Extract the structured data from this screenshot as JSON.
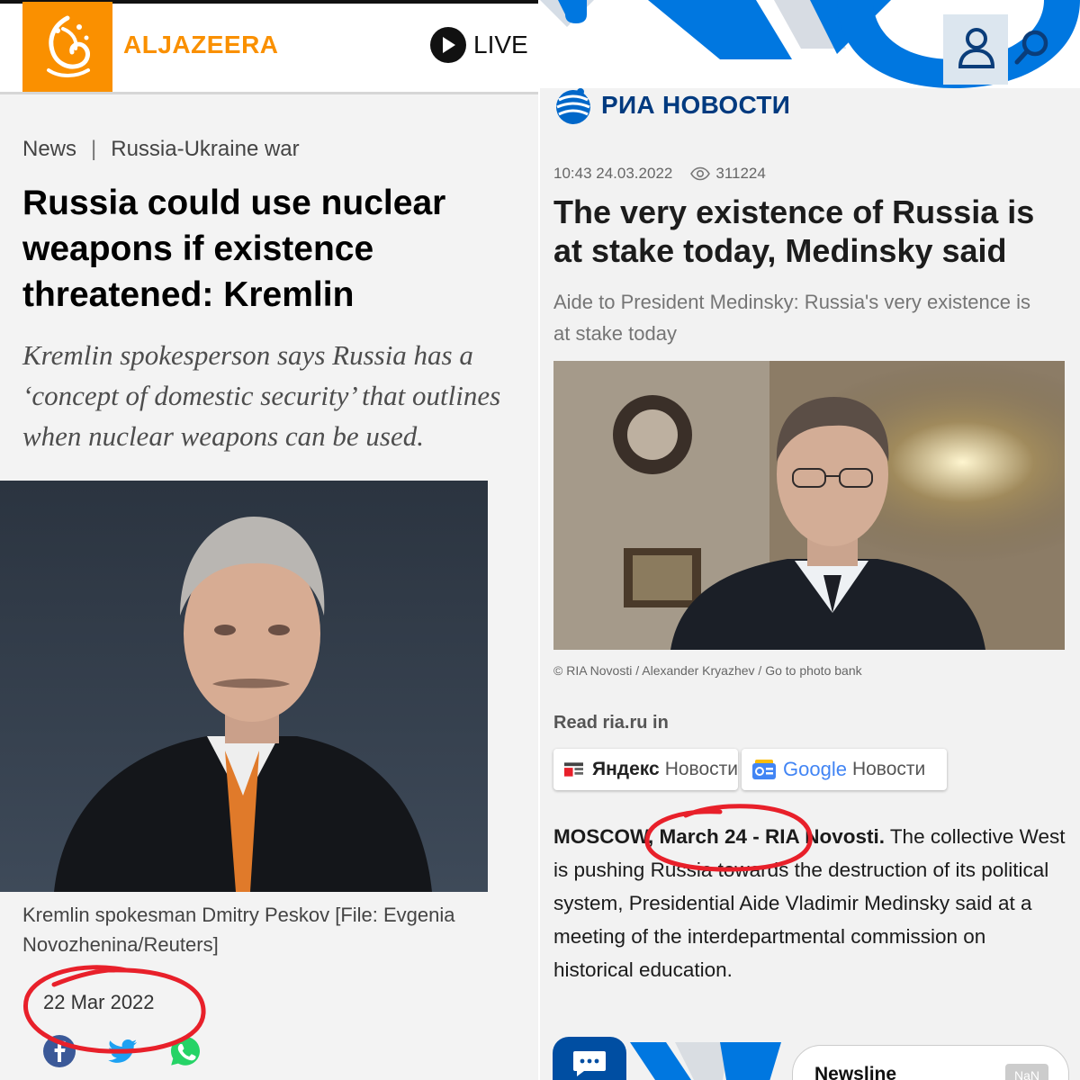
{
  "left_article": {
    "brand": "ALJAZEERA",
    "live_label": "LIVE",
    "breadcrumb": {
      "section": "News",
      "topic": "Russia-Ukraine war"
    },
    "title": "Russia could use nuclear weapons if existence threatened: Kremlin",
    "subtitle_lines": [
      "Kremlin spokesperson says Russia has a",
      "‘concept of domestic security’ that outlines",
      "when nuclear weapons can be used."
    ],
    "photo_caption": "Kremlin spokesman Dmitry Peskov [File: Evgenia Novozhenina/Reuters]",
    "date": "22 Mar 2022",
    "share_icons": [
      "facebook-icon",
      "twitter-icon",
      "whatsapp-icon"
    ]
  },
  "right_article": {
    "brand": "РИА НОВОСТИ",
    "timestamp": "10:43 24.03.2022",
    "views": "311224",
    "title": "The very existence of Russia is at stake today, Medinsky said",
    "subtitle": "Aide to President Medinsky: Russia's very existence is at stake today",
    "photo_credit": "© RIA Novosti / Alexander Kryazhev / Go to photo bank",
    "read_in_label": "Read ria.ru in",
    "aggregators": [
      {
        "name": "Яндекс",
        "suffix": "Новости"
      },
      {
        "name": "Google",
        "suffix": "Новости"
      }
    ],
    "body_lead": "MOSCOW, March 24 - RIA Novosti.",
    "body_text": " The collective West is pushing Russia towards the destruction of its political system, Presidential Aide Vladimir Medinsky said at a meeting of the interdepartmental commission on historical education.",
    "newsline_label": "Newsline",
    "newsline_badge": "NaN"
  },
  "colors": {
    "aljazeera_orange": "#fa9000",
    "ria_blue": "#0077e0",
    "ria_dark_blue": "#003a7f",
    "annotation_red": "#e8202a"
  }
}
